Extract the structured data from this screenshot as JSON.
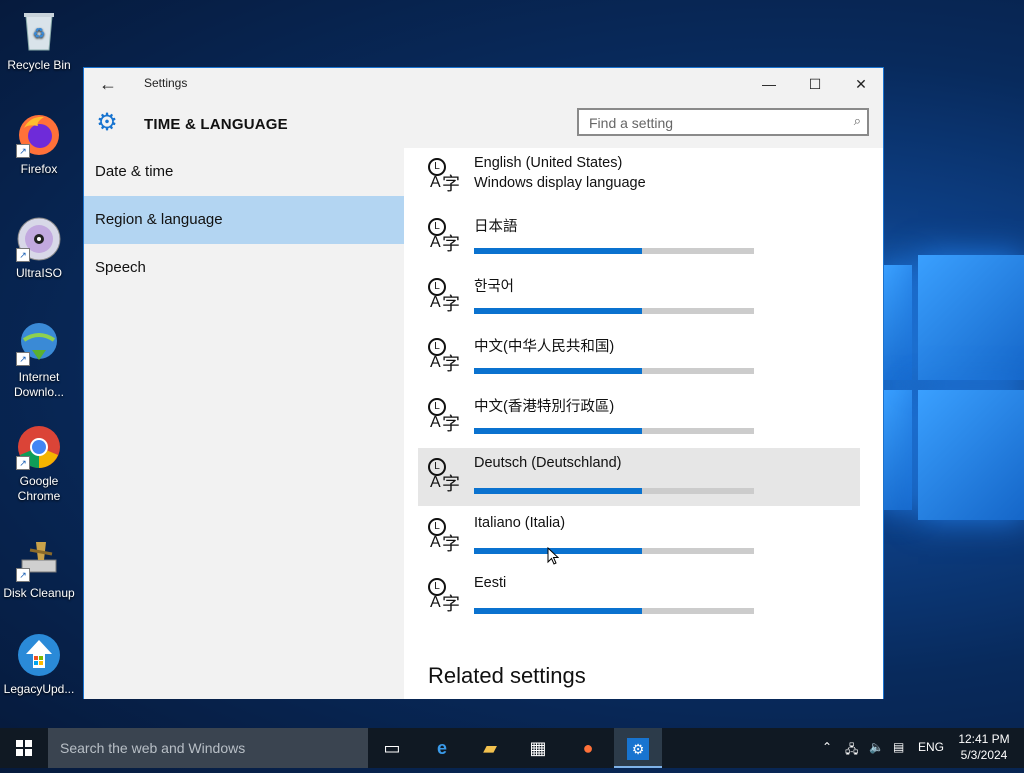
{
  "desktop_icons": [
    {
      "label": "Recycle Bin",
      "icon": "recycle-bin-icon"
    },
    {
      "label": "Firefox",
      "icon": "firefox-icon"
    },
    {
      "label": "UltraISO",
      "icon": "ultraiso-icon"
    },
    {
      "label": "Internet\nDownlo...",
      "icon": "internet-download-manager-icon"
    },
    {
      "label": "Google\nChrome",
      "icon": "chrome-icon"
    },
    {
      "label": "Disk Cleanup",
      "icon": "disk-cleanup-icon"
    },
    {
      "label": "LegacyUpd...",
      "icon": "legacy-update-icon"
    }
  ],
  "window": {
    "title": "Settings",
    "section": "TIME & LANGUAGE",
    "search_placeholder": "Find a setting"
  },
  "nav": {
    "items": [
      {
        "label": "Date & time",
        "selected": false
      },
      {
        "label": "Region & language",
        "selected": true
      },
      {
        "label": "Speech",
        "selected": false
      }
    ]
  },
  "languages": [
    {
      "name": "English (United States)",
      "sub": "Windows display language",
      "progress": null
    },
    {
      "name": "日本語",
      "sub": "",
      "progress": 0.6
    },
    {
      "name": "한국어",
      "sub": "",
      "progress": 0.6
    },
    {
      "name": "中文(中华人民共和国)",
      "sub": "",
      "progress": 0.6
    },
    {
      "name": "中文(香港特別行政區)",
      "sub": "",
      "progress": 0.6
    },
    {
      "name": "Deutsch (Deutschland)",
      "sub": "",
      "progress": 0.6
    },
    {
      "name": "Italiano (Italia)",
      "sub": "",
      "progress": 0.6
    },
    {
      "name": "Eesti",
      "sub": "",
      "progress": 0.6
    }
  ],
  "related_settings": "Related settings",
  "taskbar": {
    "search_text": "Search the web and Windows",
    "lang": "ENG",
    "time": "12:41 PM",
    "date": "5/3/2024"
  },
  "colors": {
    "accent": "#0a72cf",
    "nav_selected": "#b3d5f2",
    "taskbar": "#101923"
  }
}
